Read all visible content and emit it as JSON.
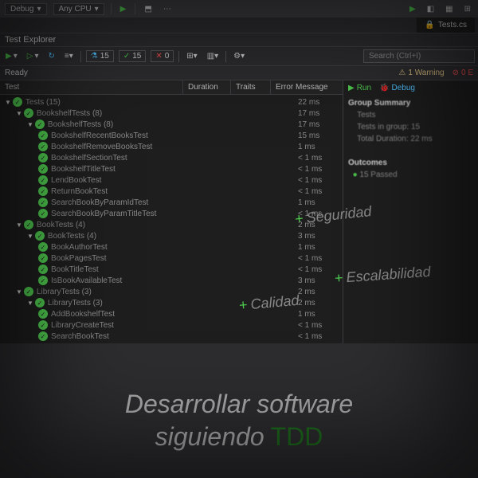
{
  "topbar": {
    "config": "Debug",
    "platform": "Any CPU"
  },
  "tab": {
    "name": "Tests.cs"
  },
  "explorer": {
    "title": "Test Explorer",
    "counts": {
      "total": "15",
      "passed": "15",
      "failed": "0"
    },
    "search_placeholder": "Search (Ctrl+I)",
    "ready": "Ready",
    "warning": "1 Warning",
    "error": "0 E",
    "headers": {
      "test": "Test",
      "duration": "Duration",
      "traits": "Traits",
      "error": "Error Message"
    }
  },
  "tree": [
    {
      "depth": 0,
      "chev": "▼",
      "label": "Tests (15)",
      "dur": "22 ms"
    },
    {
      "depth": 1,
      "chev": "▼",
      "label": "BookshelfTests (8)",
      "dur": "17 ms"
    },
    {
      "depth": 2,
      "chev": "▼",
      "label": "BookshelfTests (8)",
      "dur": "17 ms"
    },
    {
      "depth": 3,
      "label": "BookshelfRecentBooksTest",
      "dur": "15 ms"
    },
    {
      "depth": 3,
      "label": "BookshelfRemoveBooksTest",
      "dur": "1 ms"
    },
    {
      "depth": 3,
      "label": "BookshelfSectionTest",
      "dur": "< 1 ms"
    },
    {
      "depth": 3,
      "label": "BookshelfTitleTest",
      "dur": "< 1 ms"
    },
    {
      "depth": 3,
      "label": "LendBookTest",
      "dur": "< 1 ms"
    },
    {
      "depth": 3,
      "label": "ReturnBookTest",
      "dur": "< 1 ms"
    },
    {
      "depth": 3,
      "label": "SearchBookByParamIdTest",
      "dur": "1 ms"
    },
    {
      "depth": 3,
      "label": "SearchBookByParamTitleTest",
      "dur": "< 1 ms"
    },
    {
      "depth": 1,
      "chev": "▼",
      "label": "BookTests (4)",
      "dur": "2 ms"
    },
    {
      "depth": 2,
      "chev": "▼",
      "label": "BookTests (4)",
      "dur": "3 ms"
    },
    {
      "depth": 3,
      "label": "BookAuthorTest",
      "dur": "1 ms"
    },
    {
      "depth": 3,
      "label": "BookPagesTest",
      "dur": "< 1 ms"
    },
    {
      "depth": 3,
      "label": "BookTitleTest",
      "dur": "< 1 ms"
    },
    {
      "depth": 3,
      "label": "IsBookAvailableTest",
      "dur": "3 ms"
    },
    {
      "depth": 1,
      "chev": "▼",
      "label": "LibraryTests (3)",
      "dur": "2 ms"
    },
    {
      "depth": 2,
      "chev": "▼",
      "label": "LibraryTests (3)",
      "dur": "2 ms"
    },
    {
      "depth": 3,
      "label": "AddBookshelfTest",
      "dur": "1 ms"
    },
    {
      "depth": 3,
      "label": "LibraryCreateTest",
      "dur": "< 1 ms"
    },
    {
      "depth": 3,
      "label": "SearchBookTest",
      "dur": "< 1 ms"
    }
  ],
  "detail": {
    "run": "Run",
    "debug": "Debug",
    "group_summary": "Group Summary",
    "name": "Tests",
    "in_group": "Tests in group: 15",
    "total_duration": "Total Duration: 22 ms",
    "outcomes": "Outcomes",
    "passed": "15 Passed"
  },
  "tags": {
    "seguridad": "Seguridad",
    "escalabilidad": "Escalabilidad",
    "calidad": "Calidad"
  },
  "headline": {
    "line1": "Desarrollar software",
    "line2": "siguiendo",
    "tdd": "TDD"
  }
}
